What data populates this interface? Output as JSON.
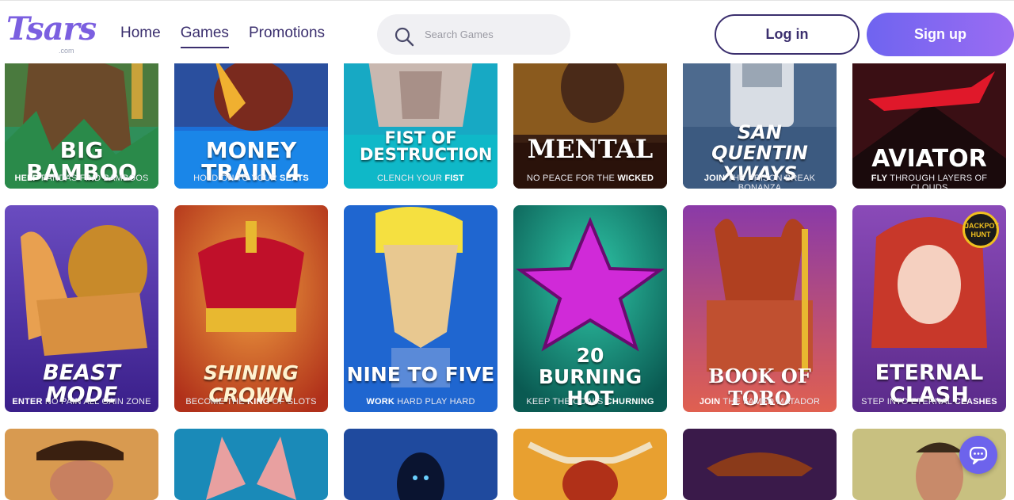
{
  "brand": {
    "logo_text": "Tsars",
    "logo_sub": ".com",
    "accent": "#6f64f0",
    "nav_color": "#3b2f6e"
  },
  "nav": {
    "items": [
      "Home",
      "Games",
      "Promotions"
    ],
    "active": "Games"
  },
  "search": {
    "placeholder": "Search Games",
    "icon": "search-icon"
  },
  "auth": {
    "login_label": "Log in",
    "signup_label": "Sign up"
  },
  "games_row1": [
    {
      "title": "BIG BAMBOO",
      "tag_pre": "HELP",
      "tag_rest": " PANDAS FIND BAMBOOS",
      "tag_bold_first": true
    },
    {
      "title": "MONEY TRAIN 4",
      "tag_pre": "HOLD ON TO YOUR ",
      "tag_rest": "SEATS",
      "tag_bold_first": false
    },
    {
      "title": "FIST OF DESTRUCTION",
      "tag_pre": "CLENCH YOUR ",
      "tag_rest": "FIST",
      "tag_bold_first": false
    },
    {
      "title": "MENTAL",
      "tag_pre": "NO PEACE FOR THE ",
      "tag_rest": "WICKED",
      "tag_bold_first": false
    },
    {
      "title": "SAN QUENTIN XWAYS",
      "tag_pre": "JOIN",
      "tag_rest": " THE PRISON BREAK BONANZA",
      "tag_bold_first": true
    },
    {
      "title": "AVIATOR",
      "tag_pre": "FLY",
      "tag_rest": " THROUGH LAYERS OF CLOUDS",
      "tag_bold_first": true
    }
  ],
  "games_row2": [
    {
      "title": "BEAST MODE",
      "tag_pre": "ENTER",
      "tag_rest": " NO PAIN ALL GAIN ZONE",
      "tag_bold_first": true
    },
    {
      "title": "SHINING CROWN",
      "tag_pre": "BECOME THE ",
      "tag_mid": "KING",
      "tag_rest": " OF SLOTS"
    },
    {
      "title": "NINE TO FIVE",
      "tag_pre": "WORK",
      "tag_rest": " HARD PLAY HARD",
      "tag_bold_first": true
    },
    {
      "title": "20 BURNING HOT",
      "tag_pre": "KEEP THE COALS ",
      "tag_rest": "CHURNING",
      "tag_bold_first": false
    },
    {
      "title": "BOOK OF TORO",
      "tag_pre": "JOIN",
      "tag_rest": " THE FAMED MATADOR",
      "tag_bold_first": true
    },
    {
      "title": "ETERNAL CLASH",
      "tag_pre": "STEP INTO ETERNAL ",
      "tag_rest": "CLASHES",
      "tag_bold_first": false
    }
  ],
  "badges": {
    "jackpot": "JACKPOT HUNT"
  },
  "chat": {
    "icon": "chat-icon"
  }
}
